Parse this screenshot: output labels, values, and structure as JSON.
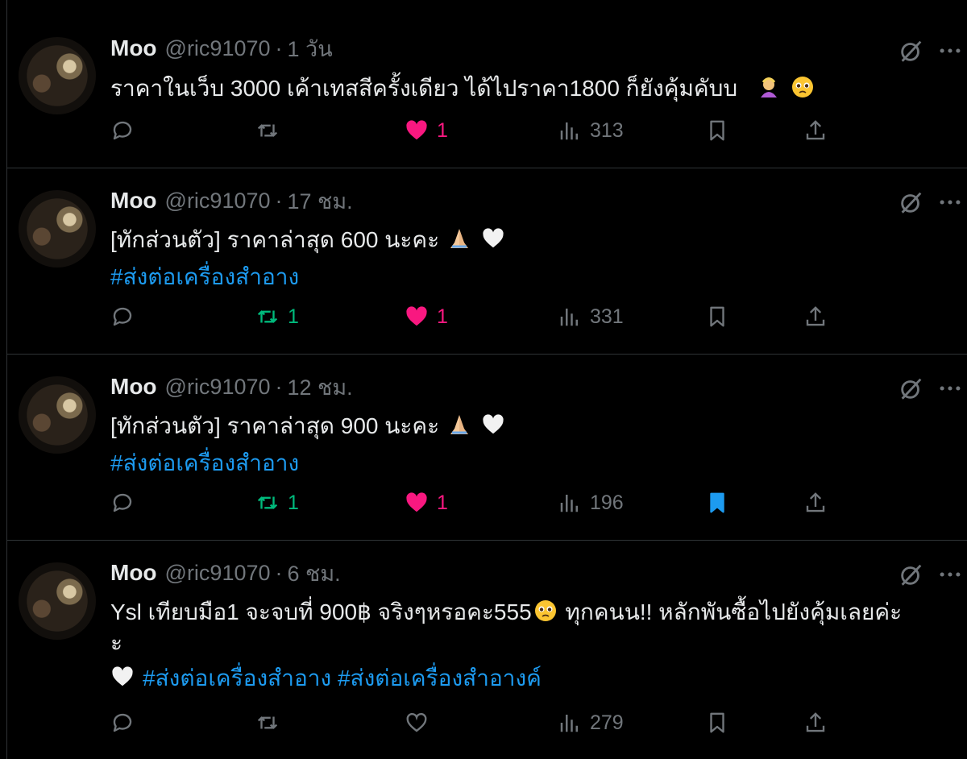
{
  "author": {
    "name": "Moo",
    "handle": "@ric91070",
    "separator": "·"
  },
  "tweets": [
    {
      "time": "1 วัน",
      "lines": [
        "ราคาในเว็บ 3000  เค้าเทสสีครั้งเดียว ได้ไปราคา1800 ก็ยังคุ้มคับบ"
      ],
      "trail_emojis": [
        "person-bowing-emoji",
        "pleading-face-emoji"
      ],
      "hashtags_line": [],
      "stats": {
        "replies": "",
        "reposts": "",
        "likes": "1",
        "views": "313"
      },
      "state": {
        "liked": true,
        "reposted": false,
        "bookmarked": false
      }
    },
    {
      "time": "17 ชม.",
      "lines": [
        "[ทักส่วนตัว] ราคาล่าสุด 600 นะคะ"
      ],
      "trail_emojis": [
        "folded-hands-emoji",
        "white-heart-emoji"
      ],
      "hashtags_line": [
        "#ส่งต่อเครื่องสำอาง"
      ],
      "stats": {
        "replies": "",
        "reposts": "1",
        "likes": "1",
        "views": "331"
      },
      "state": {
        "liked": true,
        "reposted": true,
        "bookmarked": false
      }
    },
    {
      "time": "12 ชม.",
      "lines": [
        "[ทักส่วนตัว] ราคาล่าสุด 900 นะคะ"
      ],
      "trail_emojis": [
        "folded-hands-emoji",
        "white-heart-emoji"
      ],
      "hashtags_line": [
        "#ส่งต่อเครื่องสำอาง"
      ],
      "stats": {
        "replies": "",
        "reposts": "1",
        "likes": "1",
        "views": "196"
      },
      "state": {
        "liked": true,
        "reposted": true,
        "bookmarked": true
      }
    },
    {
      "time": "6 ชม.",
      "lines": [
        "Ysl เทียบมือ1 จะจบที่ 900฿ จริงๆหรอคะ555",
        " ทุกคนน!! หลักพันซื้อไปยังคุ้มเลยค่ะ",
        "ะ"
      ],
      "trail_emojis": [],
      "hashtags_line": [
        "#ส่งต่อเครื่องสำอาง",
        "#ส่งต่อเครื่องสำอางค์"
      ],
      "stats": {
        "replies": "",
        "reposts": "",
        "likes": "",
        "views": "279"
      },
      "state": {
        "liked": false,
        "reposted": false,
        "bookmarked": false
      }
    }
  ],
  "colors": {
    "background": "#000000",
    "text": "#e7e9ea",
    "muted": "#71767b",
    "link": "#1d9bf0",
    "like": "#f91880",
    "repost": "#00ba7c",
    "divider": "#2f3336"
  }
}
